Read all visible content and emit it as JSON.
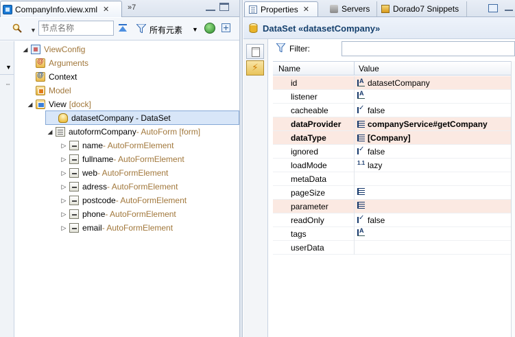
{
  "left_editor": {
    "tab_title": "CompanyInfo.view.xml",
    "overflow_label": "»7",
    "toolbar": {
      "search_placeholder": "节点名称",
      "filter_label": "所有元素"
    },
    "tree": {
      "root": "ViewConfig",
      "arguments": "Arguments",
      "context": "Context",
      "model": "Model",
      "view": "View",
      "view_suffix": "[dock]",
      "dataset": "datasetCompany - DataSet",
      "autoform": "autoformCompany",
      "autoform_suffix": " - AutoForm [form]",
      "elements": [
        {
          "name": "name",
          "type": " - AutoFormElement"
        },
        {
          "name": "fullname",
          "type": " - AutoFormElement"
        },
        {
          "name": "web",
          "type": " - AutoFormElement"
        },
        {
          "name": "adress",
          "type": " - AutoFormElement"
        },
        {
          "name": "postcode",
          "type": " - AutoFormElement"
        },
        {
          "name": "phone",
          "type": " - AutoFormElement"
        },
        {
          "name": "email",
          "type": " - AutoFormElement"
        }
      ]
    }
  },
  "right_panel": {
    "tabs": {
      "properties": "Properties",
      "servers": "Servers",
      "snippets": "Dorado7 Snippets"
    },
    "title": "DataSet «datasetCompany»",
    "filter_label": "Filter:",
    "filter_value": "",
    "columns": {
      "name": "Name",
      "value": "Value"
    },
    "properties": [
      {
        "name": "id",
        "value": "datasetCompany",
        "icon": "string-icon",
        "highlight": true,
        "bold": false
      },
      {
        "name": "listener",
        "value": "",
        "icon": "string-icon",
        "highlight": false,
        "bold": false
      },
      {
        "name": "cacheable",
        "value": "false",
        "icon": "boolean-icon",
        "highlight": false,
        "bold": false
      },
      {
        "name": "dataProvider",
        "value": "companyService#getCompany",
        "icon": "list-icon",
        "highlight": true,
        "bold": true
      },
      {
        "name": "dataType",
        "value": "[Company]",
        "icon": "list-icon",
        "highlight": true,
        "bold": true
      },
      {
        "name": "ignored",
        "value": "false",
        "icon": "boolean-icon",
        "highlight": false,
        "bold": false
      },
      {
        "name": "loadMode",
        "value": "lazy",
        "icon": "number-icon",
        "highlight": false,
        "bold": false
      },
      {
        "name": "metaData",
        "value": "",
        "icon": "",
        "highlight": false,
        "bold": false
      },
      {
        "name": "pageSize",
        "value": "",
        "icon": "list-icon",
        "highlight": false,
        "bold": false
      },
      {
        "name": "parameter",
        "value": "",
        "icon": "list-icon",
        "highlight": true,
        "bold": false
      },
      {
        "name": "readOnly",
        "value": "false",
        "icon": "boolean-icon",
        "highlight": false,
        "bold": false
      },
      {
        "name": "tags",
        "value": "",
        "icon": "string-icon",
        "highlight": false,
        "bold": false
      },
      {
        "name": "userData",
        "value": "",
        "icon": "",
        "highlight": false,
        "bold": false
      }
    ]
  }
}
